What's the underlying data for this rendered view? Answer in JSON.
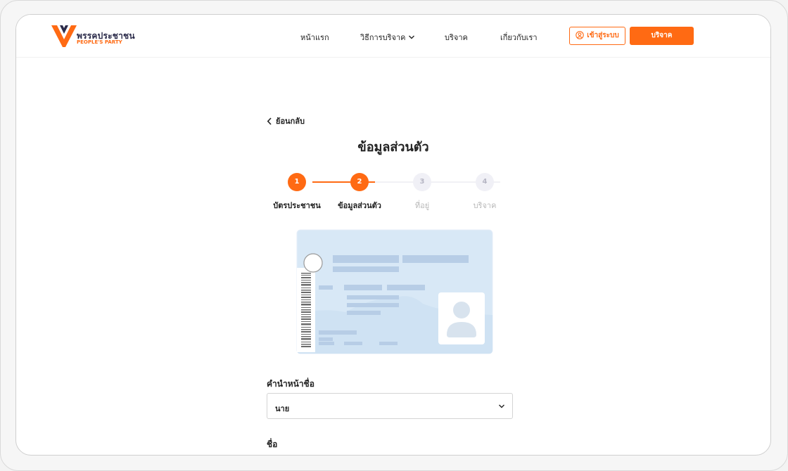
{
  "header": {
    "logo_title": "พรรคประชาชน",
    "logo_subtitle": "PEOPLE'S PARTY",
    "nav": [
      {
        "label": "หน้าแรก"
      },
      {
        "label": "วิธีการบริจาค"
      },
      {
        "label": "บริจาค"
      },
      {
        "label": "เกี่ยวกับเรา"
      }
    ],
    "login_label": "เข้าสู่ระบบ",
    "donate_label": "บริจาค"
  },
  "page": {
    "back_label": "ย้อนกลับ",
    "title": "ข้อมูลส่วนตัว"
  },
  "stepper": {
    "steps": [
      {
        "number": "1",
        "label": "บัตรประชาชน",
        "state": "done"
      },
      {
        "number": "2",
        "label": "ข้อมูลส่วนตัว",
        "state": "current"
      },
      {
        "number": "3",
        "label": "ที่อยู่",
        "state": "pending"
      },
      {
        "number": "4",
        "label": "บริจาค",
        "state": "pending"
      }
    ]
  },
  "form": {
    "title_prefix_label": "คำนำหน้าชื่อ",
    "title_prefix_value": "นาย",
    "first_name_label": "ชื่อ"
  },
  "colors": {
    "accent": "#ff6a13",
    "nav_text": "#2b2b4a",
    "card_bg": "#d8e8f6",
    "card_bar": "#b7cde6"
  },
  "icons": {
    "logo": "party-logo",
    "nav_dropdown": "chevron-down-icon",
    "login": "user-circle-icon",
    "back": "chevron-left-icon",
    "select": "chevron-down-icon",
    "id_card": "id-card-illustration"
  }
}
